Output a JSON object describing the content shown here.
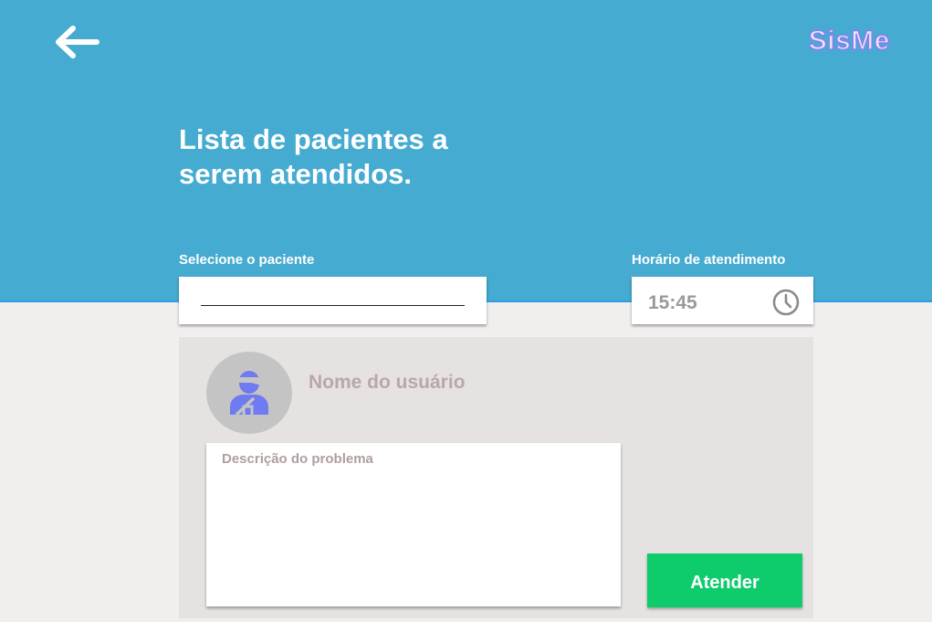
{
  "header": {
    "brand": "SisMe",
    "title": "Lista de pacientes a serem atendidos.",
    "back_icon": "arrow-left-icon"
  },
  "form": {
    "patient_label": "Selecione o paciente",
    "patient_value": "",
    "time_label": "Horário de atendimento",
    "time_value": "15:45",
    "time_icon": "clock-icon"
  },
  "card": {
    "avatar_icon": "injured-person-icon",
    "user_name": "Nome do usuário",
    "description_placeholder": "Descrição do problema",
    "description_value": "",
    "button_label": "Atender"
  },
  "colors": {
    "header_bg": "#46abd0",
    "page_bg": "#f0efee",
    "card_bg": "#e6e2e1",
    "button_bg": "#0ecb6c",
    "avatar_icon": "#6f7bf0",
    "brand_outline": "#8c7df0"
  }
}
